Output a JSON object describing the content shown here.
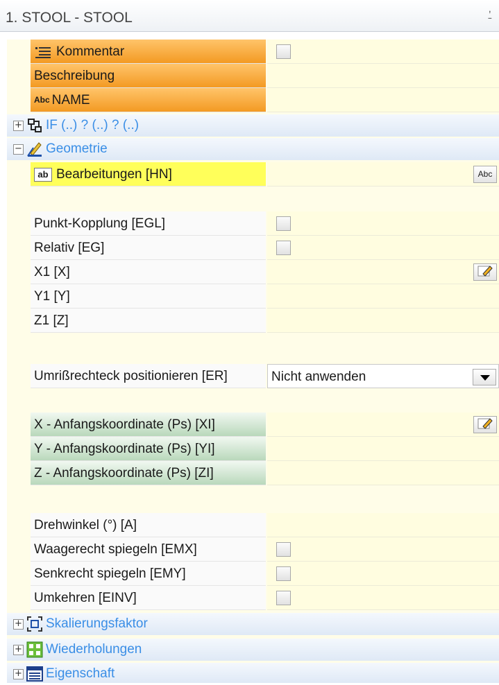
{
  "panel": {
    "title": "1. STOOL - STOOL",
    "pin_glyph": "Ն"
  },
  "top_rows": {
    "kommentar": "Kommentar",
    "beschreibung": "Beschreibung",
    "name": "NAME"
  },
  "groups": {
    "if": "IF (..) ? (..) ? (..)",
    "geometrie": "Geometrie",
    "skalierung": "Skalierungsfaktor",
    "wiederholungen": "Wiederholungen",
    "eigenschaft": "Eigenschaft"
  },
  "geometrie": {
    "bearbeitungen": "Bearbeitungen [HN]",
    "punkt_kopplung": "Punkt-Kopplung [EGL]",
    "relativ": "Relativ [EG]",
    "x1": "X1 [X]",
    "y1": "Y1 [Y]",
    "z1": "Z1 [Z]",
    "umriss": "Umrißrechteck positionieren [ER]",
    "umriss_value": "Nicht anwenden",
    "xi": "X - Anfangskoordinate (Ps) [XI]",
    "yi": "Y - Anfangskoordinate (Ps) [YI]",
    "zi": "Z - Anfangskoordinate (Ps) [ZI]",
    "drehwinkel": "Drehwinkel (°) [A]",
    "emx": "Waagerecht spiegeln [EMX]",
    "emy": "Senkrecht spiegeln [EMY]",
    "einv": "Umkehren [EINV]"
  },
  "icons": {
    "abc_button": "Abc",
    "ab_icon": "ab",
    "abc_small": "Abc"
  }
}
